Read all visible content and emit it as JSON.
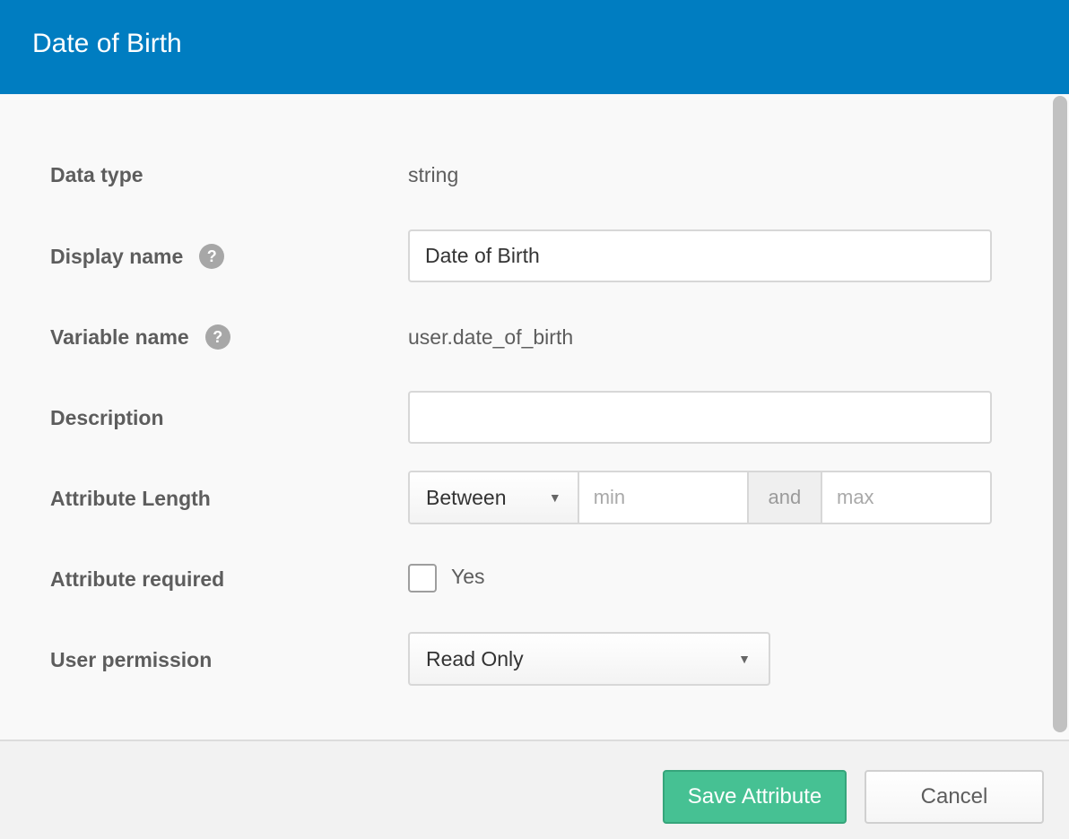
{
  "dialog": {
    "title": "Date of Birth"
  },
  "fields": {
    "data_type": {
      "label": "Data type",
      "value": "string"
    },
    "display_name": {
      "label": "Display name",
      "help": "?",
      "value": "Date of Birth"
    },
    "variable_name": {
      "label": "Variable name",
      "help": "?",
      "value": "user.date_of_birth"
    },
    "description": {
      "label": "Description",
      "value": ""
    },
    "attribute_length": {
      "label": "Attribute Length",
      "mode": "Between",
      "min_placeholder": "min",
      "and_text": "and",
      "max_placeholder": "max"
    },
    "attribute_required": {
      "label": "Attribute required",
      "checkbox_label": "Yes",
      "checked": false
    },
    "user_permission": {
      "label": "User permission",
      "value": "Read Only"
    }
  },
  "footer": {
    "save_label": "Save Attribute",
    "cancel_label": "Cancel"
  },
  "colors": {
    "header": "#007dc1",
    "save_button": "#46c193"
  },
  "icons": {
    "help": "question-mark-circle",
    "dropdown": "caret-down"
  }
}
